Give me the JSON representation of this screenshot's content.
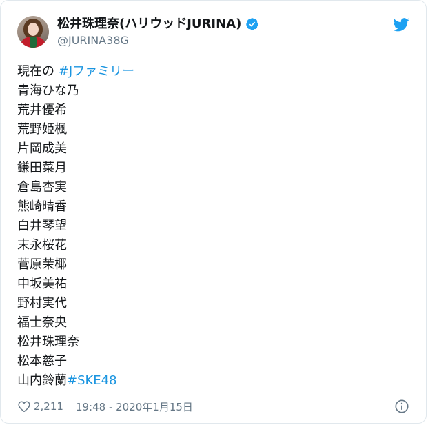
{
  "user": {
    "display_name": "松井珠理奈(ハリウッドJURINA)",
    "handle": "@JURINA38G",
    "verified": true,
    "avatar_icon": "profile-photo-avatar"
  },
  "brand": {
    "icon": "twitter-bird-icon",
    "color": "#1da1f2"
  },
  "tweet": {
    "intro_text": "現在の ",
    "intro_hashtag": "#Jファミリー",
    "members": [
      "青海ひな乃",
      "荒井優希",
      "荒野姫楓",
      "片岡成美",
      "鎌田菜月",
      "倉島杏実",
      "熊崎晴香",
      "白井琴望",
      "末永桜花",
      "菅原茉椰",
      "中坂美祐",
      "野村実代",
      "福士奈央",
      "松井珠理奈",
      "松本慈子"
    ],
    "last_member": "山内鈴蘭",
    "last_hashtag": "#SKE48",
    "hashtag_color": "#1b95e0"
  },
  "footer": {
    "like_icon": "heart-icon",
    "like_count": "2,211",
    "timestamp": "19:48 - 2020年1月15日",
    "info_icon": "info-icon"
  }
}
